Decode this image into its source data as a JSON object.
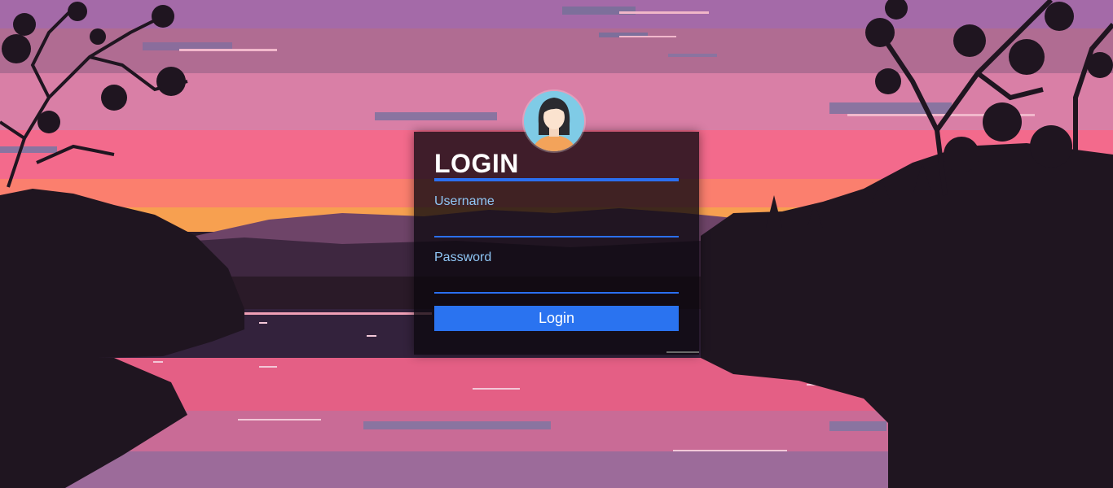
{
  "login": {
    "title": "LOGIN",
    "username_label": "Username",
    "username_value": "",
    "password_label": "Password",
    "password_value": "",
    "submit_label": "Login"
  },
  "avatar": {
    "icon": "user-avatar-icon"
  },
  "colors": {
    "accent": "#2b6ff0",
    "label": "#8fc6f5",
    "card": "#0c080e"
  }
}
